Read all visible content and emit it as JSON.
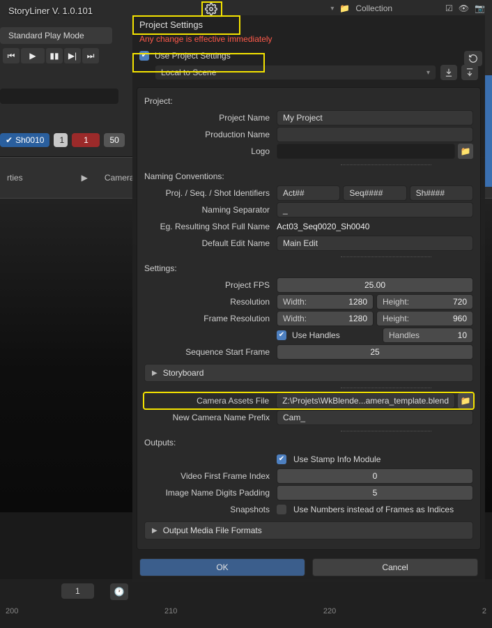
{
  "app": {
    "title": "StoryLiner V. 1.0.101"
  },
  "outliner": {
    "collection": "Collection"
  },
  "underlay": {
    "play_mode_label": "Standard Play Mode",
    "shot_chip": "Sh0010",
    "shot_white": "1",
    "shot_red": "1",
    "shot_gray": "50",
    "mid_left": "rties",
    "mid_right": "Camera B",
    "timeline_one": "1",
    "ruler": [
      "200",
      "210",
      "220",
      "2"
    ]
  },
  "dialog": {
    "title": "Project Settings",
    "warning": "Any change is effective immediately",
    "use_project_settings": {
      "label": "Use Project Settings",
      "checked": true
    },
    "scope": {
      "value": "Local to Scene"
    },
    "project": {
      "section": "Project:",
      "project_name": {
        "label": "Project Name",
        "value": "My Project"
      },
      "production_name": {
        "label": "Production Name",
        "value": ""
      },
      "logo": {
        "label": "Logo",
        "value": ""
      }
    },
    "naming": {
      "section": "Naming Conventions:",
      "identifiers": {
        "label": "Proj. / Seq. / Shot Identifiers",
        "proj": "Act##",
        "seq": "Seq####",
        "shot": "Sh####"
      },
      "separator": {
        "label": "Naming Separator",
        "value": "_"
      },
      "example": {
        "label": "Eg. Resulting Shot Full Name",
        "value": "Act03_Seq0020_Sh0040"
      },
      "default_edit": {
        "label": "Default Edit Name",
        "value": "Main Edit"
      }
    },
    "settings": {
      "section": "Settings:",
      "fps": {
        "label": "Project FPS",
        "value": "25.00"
      },
      "resolution": {
        "label": "Resolution",
        "w_label": "Width:",
        "w": "1280",
        "h_label": "Height:",
        "h": "720"
      },
      "frame_resolution": {
        "label": "Frame Resolution",
        "w_label": "Width:",
        "w": "1280",
        "h_label": "Height:",
        "h": "960"
      },
      "use_handles": {
        "label": "Use Handles",
        "checked": true,
        "handles_label": "Handles",
        "handles": "10"
      },
      "seq_start": {
        "label": "Sequence Start Frame",
        "value": "25"
      },
      "storyboard": "Storyboard",
      "camera_assets": {
        "label": "Camera Assets File",
        "value": "Z:\\Projets\\WkBlende...amera_template.blend"
      },
      "cam_prefix": {
        "label": "New Camera Name Prefix",
        "value": "Cam_"
      }
    },
    "outputs": {
      "section": "Outputs:",
      "use_stamp": {
        "label": "Use Stamp Info Module",
        "checked": true
      },
      "vffi": {
        "label": "Video First Frame Index",
        "value": "0"
      },
      "digits": {
        "label": "Image Name Digits Padding",
        "value": "5"
      },
      "snapshots": {
        "label": "Snapshots",
        "check_label": "Use Numbers instead of Frames as Indices",
        "checked": false
      },
      "formats": "Output Media File Formats"
    },
    "buttons": {
      "ok": "OK",
      "cancel": "Cancel"
    }
  }
}
